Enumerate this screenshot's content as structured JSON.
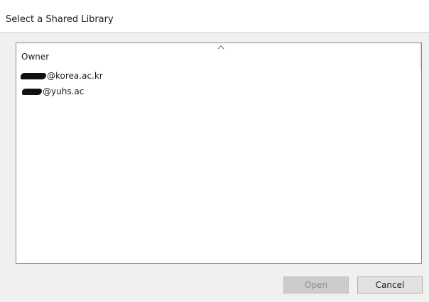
{
  "dialog": {
    "title": "Select a Shared Library"
  },
  "list": {
    "column_header": "Owner",
    "sort_icon": "chevron-up-icon",
    "items": [
      {
        "owner": "@korea.ac.kr",
        "redacted_prefix": true
      },
      {
        "owner": "@yuhs.ac",
        "redacted_prefix": true
      }
    ]
  },
  "buttons": {
    "open_label": "Open",
    "open_enabled": false,
    "cancel_label": "Cancel"
  },
  "colors": {
    "dialog_background": "#f0f0f0",
    "list_background": "#ffffff",
    "list_border": "#828790",
    "disabled_button": "#cccccc",
    "button": "#e1e1e1"
  }
}
